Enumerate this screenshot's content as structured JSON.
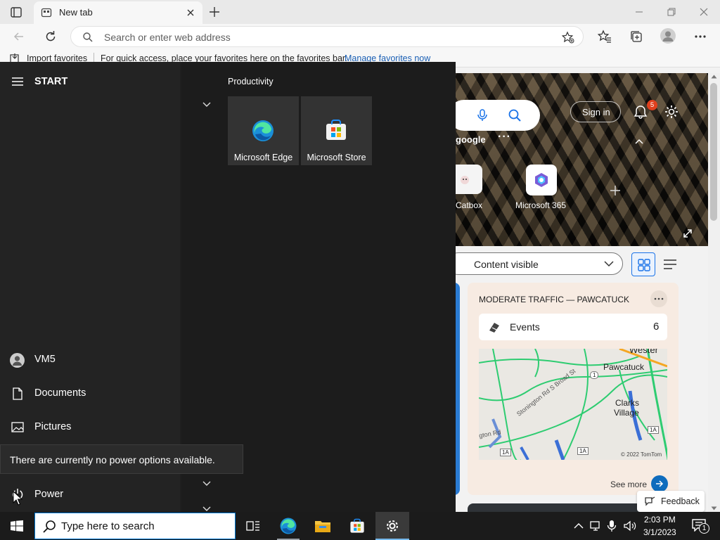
{
  "browser": {
    "tab_title": "New tab",
    "address_placeholder": "Search or enter web address",
    "favorites": {
      "import_label": "Import favorites",
      "quick_access_text": "For quick access, place your favorites here on the favorites bar.",
      "manage_link": "Manage favorites now"
    }
  },
  "newtab": {
    "sign_in": "Sign in",
    "notification_count": "5",
    "search_suggestion": "google",
    "quick_links": [
      {
        "label": "Catbox"
      },
      {
        "label": "Microsoft 365"
      }
    ],
    "content_visibility": "Content visible",
    "traffic_card": {
      "title": "MODERATE TRAFFIC — PAWCATUCK",
      "events_label": "Events",
      "events_count": "6",
      "map_labels": {
        "westerly": "Wester",
        "pawcatuck": "Pawcatuck",
        "clarks": "Clarks",
        "village": "Village",
        "stonington": "Stonington Rd S Broad St",
        "route_1a_a": "1A",
        "route_1a_b": "1A",
        "route_1a_c": "1A",
        "route_1": "1",
        "stonington_rd": "gton Rd",
        "copyright": "© 2022 TomTom"
      },
      "see_more": "See more"
    },
    "feedback": "Feedback"
  },
  "start_menu": {
    "header": "START",
    "group_title": "Productivity",
    "tiles": [
      {
        "label": "Microsoft Edge"
      },
      {
        "label": "Microsoft Store"
      }
    ],
    "user": "VM5",
    "documents": "Documents",
    "pictures": "Pictures",
    "power": "Power",
    "power_tooltip": "There are currently no power options available."
  },
  "taskbar": {
    "search_placeholder": "Type here to search",
    "time": "2:03 PM",
    "date": "3/1/2023",
    "notification_count": "1"
  },
  "colors": {
    "accent": "#0078d4",
    "start_bg": "#1f1f1f",
    "taskbar_bg": "#1b1b1b"
  }
}
